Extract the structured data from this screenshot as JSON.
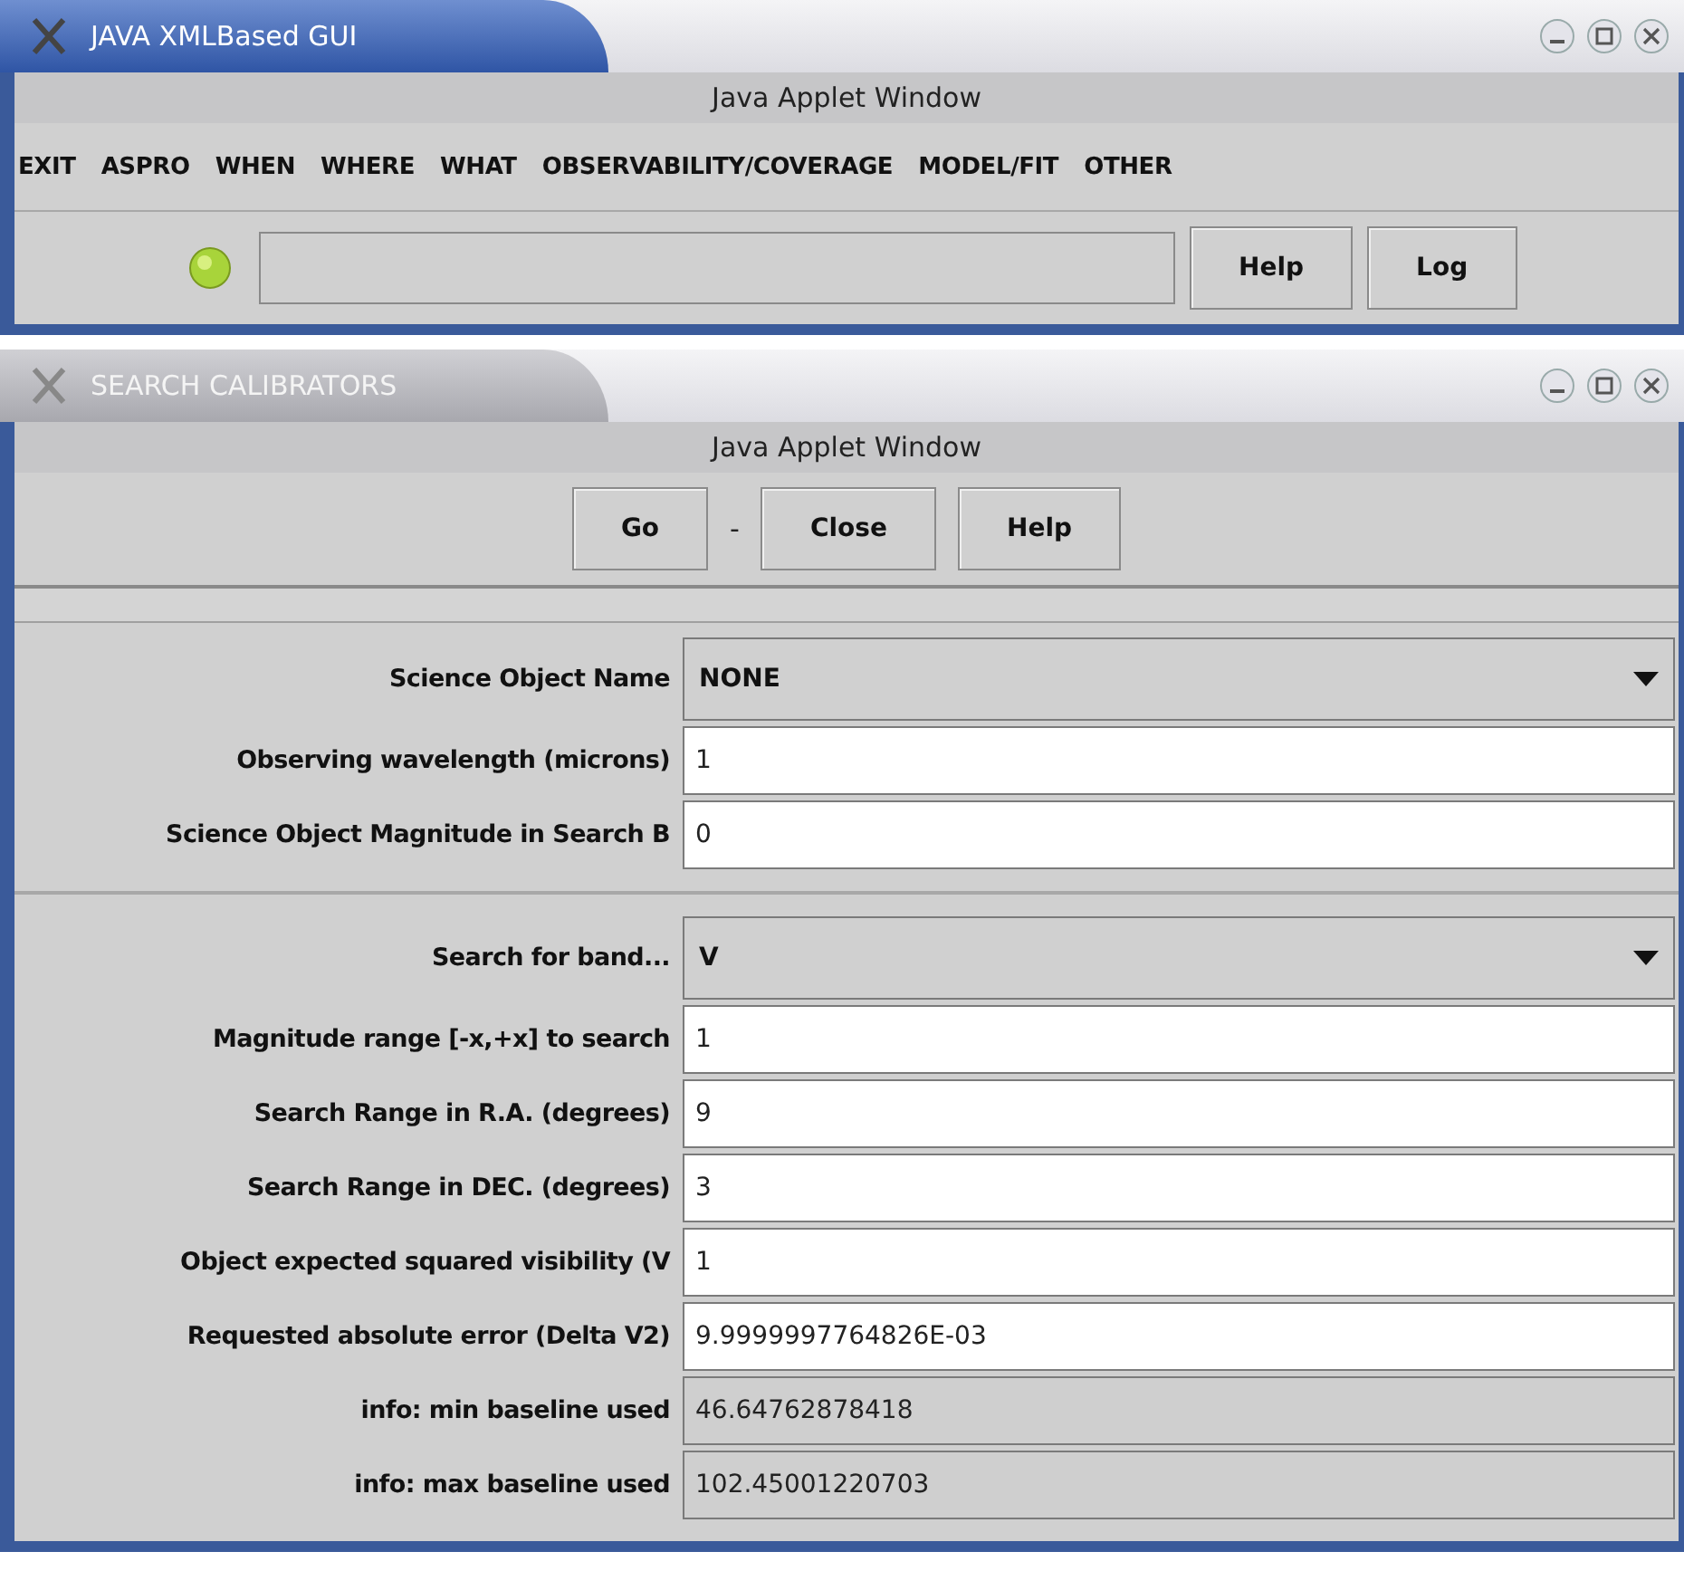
{
  "windows": [
    {
      "title": "JAVA XMLBased GUI",
      "active": true,
      "applet_label": "Java Applet Window",
      "menu": [
        "EXIT",
        "ASPRO",
        "WHEN",
        "WHERE",
        "WHAT",
        "OBSERVABILITY/COVERAGE",
        "MODEL/FIT",
        "OTHER"
      ],
      "toolbar": {
        "buttons": [
          "Help",
          "Log"
        ]
      }
    },
    {
      "title": "SEARCH CALIBRATORS",
      "active": false,
      "applet_label": "Java Applet Window",
      "actions": [
        {
          "kind": "button",
          "label": "Go"
        },
        {
          "kind": "separator",
          "label": "-"
        },
        {
          "kind": "button",
          "label": "Close"
        },
        {
          "kind": "button",
          "label": "Help"
        }
      ],
      "groups": [
        [
          {
            "label": "Science Object Name",
            "kind": "combo",
            "value": "NONE"
          },
          {
            "label": "Observing wavelength (microns)",
            "kind": "text",
            "value": "1"
          },
          {
            "label": "Science Object Magnitude in Search B",
            "kind": "text",
            "value": "0"
          }
        ],
        [
          {
            "label": "Search for band...",
            "kind": "combo",
            "value": "V"
          },
          {
            "label": "Magnitude range [-x,+x] to search",
            "kind": "text",
            "value": "1"
          },
          {
            "label": "Search Range in R.A. (degrees)",
            "kind": "text",
            "value": "9"
          },
          {
            "label": "Search Range in DEC. (degrees)",
            "kind": "text",
            "value": "3"
          },
          {
            "label": "Object expected squared visibility (V",
            "kind": "text",
            "value": "1"
          },
          {
            "label": "Requested absolute error (Delta V2)",
            "kind": "text",
            "value": "9.9999997764826E-03"
          },
          {
            "label": "info: min baseline used",
            "kind": "readonly",
            "value": "46.64762878418"
          },
          {
            "label": "info: max baseline used",
            "kind": "readonly",
            "value": "102.45001220703"
          }
        ]
      ]
    }
  ]
}
